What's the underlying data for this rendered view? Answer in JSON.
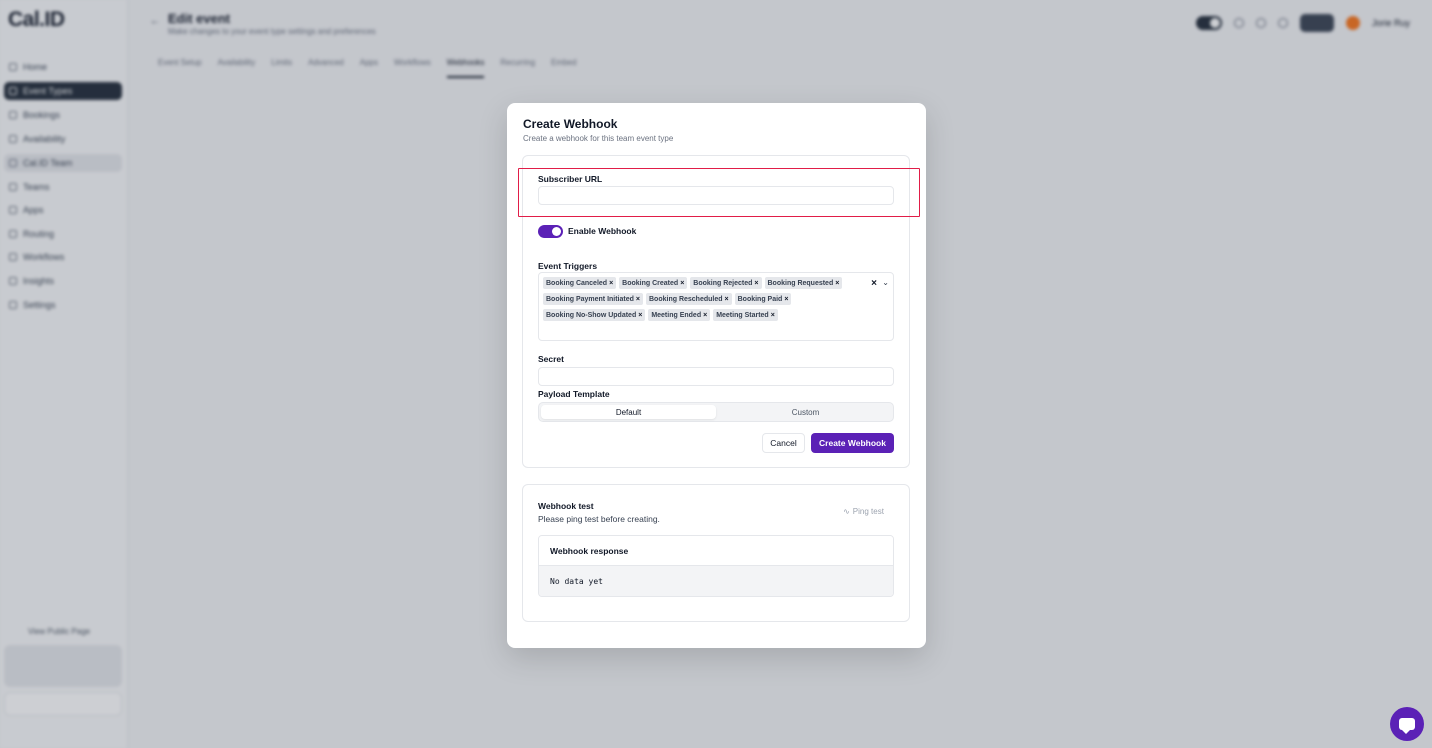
{
  "app": {
    "logo": "Cal.ID",
    "header_title": "Edit event",
    "header_subtitle": "Make changes to your event type settings and preferences",
    "back_icon": "arrow-left-icon",
    "nav": [
      {
        "label": "Home"
      },
      {
        "label": "Event Types"
      },
      {
        "label": "Bookings"
      },
      {
        "label": "Availability"
      },
      {
        "label": "Cal.ID Team"
      },
      {
        "label": "Teams"
      },
      {
        "label": "Apps"
      },
      {
        "label": "Routing"
      },
      {
        "label": "Workflows"
      },
      {
        "label": "Insights"
      },
      {
        "label": "Settings"
      }
    ],
    "view_public_page": "View Public Page",
    "tabs": [
      {
        "label": "Event Setup"
      },
      {
        "label": "Availability"
      },
      {
        "label": "Limits"
      },
      {
        "label": "Advanced"
      },
      {
        "label": "Apps"
      },
      {
        "label": "Workflows"
      },
      {
        "label": "Webhooks"
      },
      {
        "label": "Recurring"
      },
      {
        "label": "Embed"
      }
    ],
    "user_name": "Jorie Ruy"
  },
  "modal": {
    "title": "Create Webhook",
    "subtitle": "Create a webhook for this team event type",
    "subscriber_url_label": "Subscriber URL",
    "subscriber_url_value": "",
    "enable_label": "Enable Webhook",
    "enabled": true,
    "event_triggers_label": "Event Triggers",
    "triggers": [
      "Booking Canceled",
      "Booking Created",
      "Booking Rejected",
      "Booking Requested",
      "Booking Payment Initiated",
      "Booking Rescheduled",
      "Booking Paid",
      "Booking No-Show Updated",
      "Meeting Ended",
      "Meeting Started"
    ],
    "chip_remove": "×",
    "clear_icon": "×",
    "chevron_icon": "⌄",
    "secret_label": "Secret",
    "secret_value": "",
    "payload_label": "Payload Template",
    "payload_options": [
      "Default",
      "Custom"
    ],
    "payload_selected": "Default",
    "cancel_label": "Cancel",
    "create_label": "Create Webhook"
  },
  "webhook_test": {
    "title": "Webhook test",
    "subtitle": "Please ping test before creating.",
    "ping_label": "Ping test",
    "response_title": "Webhook response",
    "response_body": "No data yet"
  },
  "colors": {
    "accent": "#5b21b6",
    "highlight": "#e11d48"
  }
}
